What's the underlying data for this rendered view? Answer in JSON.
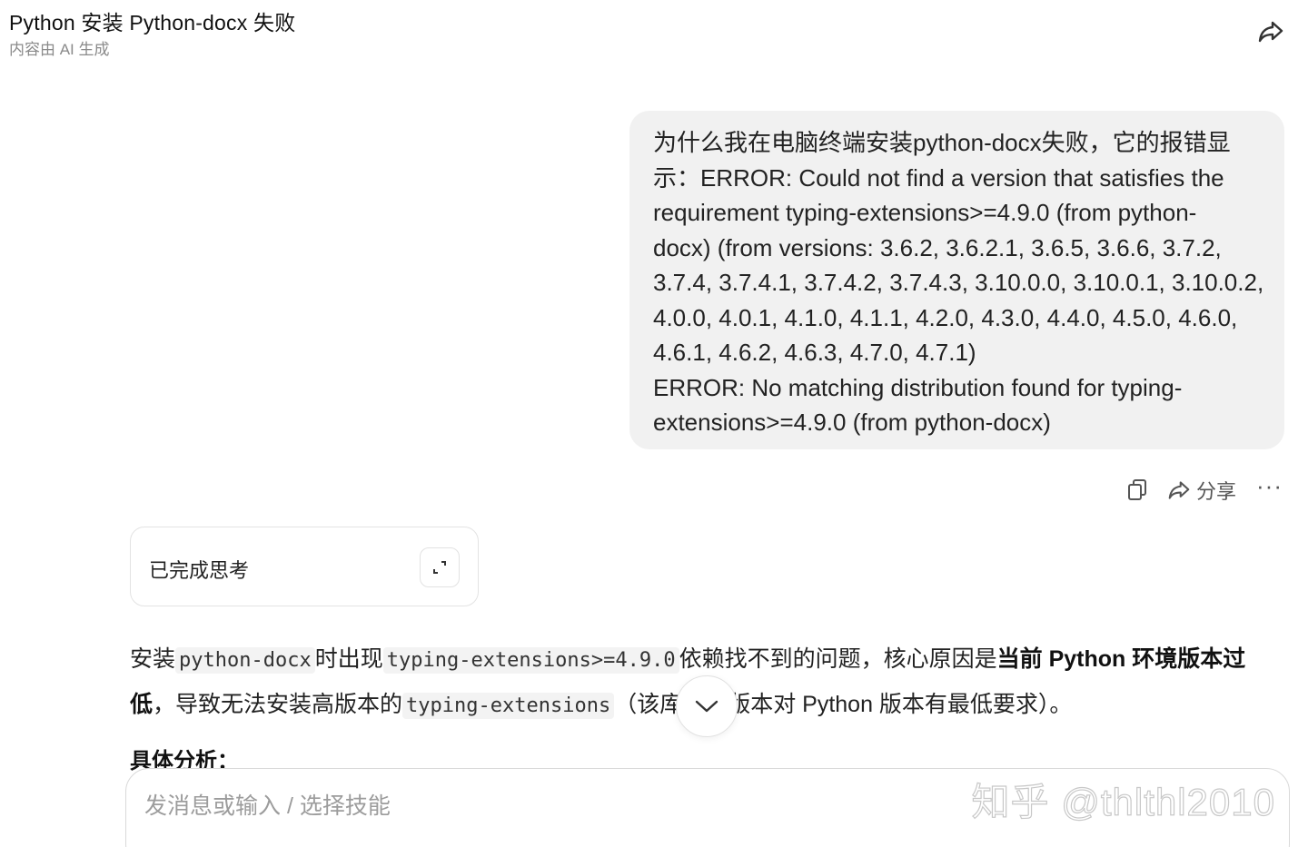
{
  "header": {
    "title": "Python 安装 Python-docx 失败",
    "subtitle": "内容由 AI 生成"
  },
  "user_message": {
    "lines": [
      "为什么我在电脑终端安装python-docx失败，它的报错显",
      "示：ERROR: Could not find a version that satisfies the",
      "requirement typing-extensions>=4.9.0 (from python-",
      "docx) (from versions: 3.6.2, 3.6.2.1, 3.6.5, 3.6.6, 3.7.2,",
      "3.7.4, 3.7.4.1, 3.7.4.2, 3.7.4.3, 3.10.0.0, 3.10.0.1, 3.10.0.2,",
      "4.0.0, 4.0.1, 4.1.0, 4.1.1, 4.2.0, 4.3.0, 4.4.0, 4.5.0, 4.6.0,",
      "4.6.1, 4.6.2, 4.6.3, 4.7.0, 4.7.1)",
      "ERROR: No matching distribution found for typing-",
      "extensions>=4.9.0 (from python-docx)"
    ]
  },
  "message_actions": {
    "copy_icon": "copy-icon",
    "share_label": "分享",
    "more_label": "···"
  },
  "thinking": {
    "label": "已完成思考",
    "expand_icon": "expand-icon"
  },
  "answer": {
    "p1_a": "安装",
    "p1_code1": "python-docx",
    "p1_b": "时出现",
    "p1_code2": "typing-extensions>=4.9.0",
    "p1_c": "依赖找不到的问题，核心原因是",
    "p1_bold": "当前 Python 环境版本过低",
    "p1_d": "，导致无法安装高版本的",
    "p1_code3": "typing-extensions",
    "p1_e": "（该库的高版本对 Python 版本有最低要求）。",
    "heading": "具体分析："
  },
  "input": {
    "placeholder": "发消息或输入 / 选择技能"
  },
  "watermark": "知乎 @thlthl2010",
  "colors": {
    "bubble_bg": "#f1f1f1",
    "text": "#222222",
    "muted": "#8a8a8a"
  }
}
